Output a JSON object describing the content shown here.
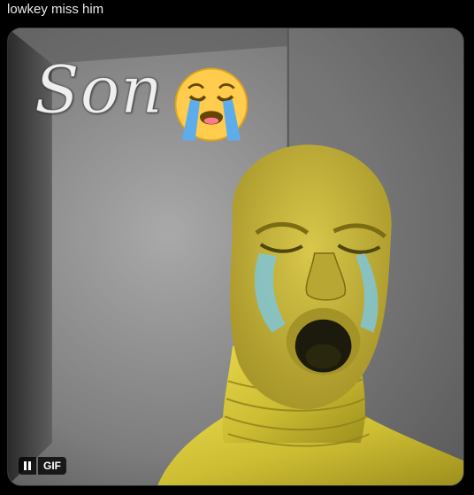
{
  "post": {
    "text": "lowkey miss him"
  },
  "media": {
    "caption": "Son",
    "emoji": "loudly-crying-face-icon",
    "gif_badge": "GIF",
    "pause_icon": "pause-icon"
  },
  "colors": {
    "background": "#000000",
    "text": "#e7e9ea",
    "suit_yellow": "#d8c93a",
    "tears_blue": "#7fc6d8"
  }
}
